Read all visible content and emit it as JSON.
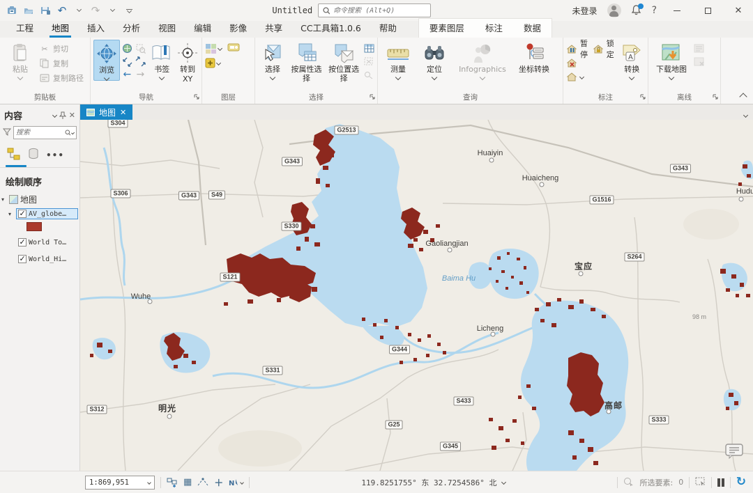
{
  "colors": {
    "accent": "#1786c6",
    "explore_highlight": "#b5daf2",
    "layer_swatch": "#ab3a2c",
    "flood_red": "#8c281e",
    "water": "#badbf0",
    "map_bg": "#f0ede6"
  },
  "titlebar": {
    "title": "Untitled",
    "search_placeholder": "命令搜索 (Alt+Q)",
    "signin": "未登录",
    "help": "?"
  },
  "tabs": {
    "items": [
      "工程",
      "地图",
      "插入",
      "分析",
      "视图",
      "编辑",
      "影像",
      "共享",
      "CC工具箱1.0.6",
      "帮助"
    ],
    "contextual": [
      "要素图层",
      "标注",
      "数据"
    ]
  },
  "ribbon": {
    "clipboard": {
      "group": "剪贴板",
      "paste": "粘贴",
      "cut": "剪切",
      "copy": "复制",
      "copy_path": "复制路径"
    },
    "navigate": {
      "group": "导航",
      "explore": "浏览",
      "bookmarks": "书签",
      "goto_xy_1": "转到",
      "goto_xy_2": "XY"
    },
    "layer": {
      "group": "图层"
    },
    "selection": {
      "group": "选择",
      "select": "选择",
      "by_attr": "按属性选择",
      "by_loc": "按位置选择"
    },
    "inquiry": {
      "group": "查询",
      "measure": "测量",
      "locate": "定位",
      "infographics": "Infographics",
      "coord": "坐标转换"
    },
    "labeling": {
      "group": "标注",
      "pause": "暂停",
      "lock": "锁定",
      "convert": "转换"
    },
    "offline": {
      "group": "离线",
      "download": "下载地图"
    }
  },
  "contents": {
    "title": "内容",
    "search_placeholder": "搜索",
    "heading": "绘制顺序",
    "map_node": "地图",
    "layers": [
      {
        "name": "AV_globe…"
      },
      {
        "name": "World To…"
      },
      {
        "name": "World_Hi…"
      }
    ]
  },
  "map": {
    "tab": "地图",
    "road_badges": [
      "S304",
      "G2513",
      "G343",
      "S306",
      "G343",
      "S49",
      "S330",
      "G1516",
      "G343",
      "S264",
      "S121",
      "S331",
      "S312",
      "G344",
      "S433",
      "G25",
      "G345",
      "S333"
    ],
    "places": [
      "Huaiyin",
      "Huaicheng",
      "Hudu",
      "Gaoliangjian",
      "宝应",
      "Wuhe",
      "Licheng",
      "明光",
      "高邮"
    ],
    "water_label": "Baima Hu",
    "elevation": "98 m"
  },
  "statusbar": {
    "scale": "1:869,951",
    "coords": "119.8251755° 东  32.7254586° 北",
    "selected_label": "所选要素:",
    "selected_count": "0"
  }
}
